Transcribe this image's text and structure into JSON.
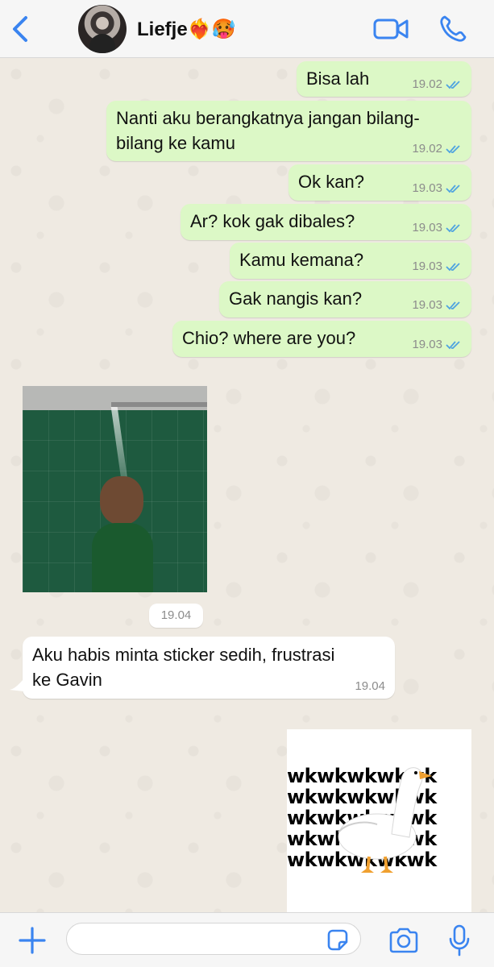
{
  "header": {
    "contact_name": "Liefje❤️‍🔥🥵",
    "back_icon": "chevron-left-icon",
    "video_icon": "video-call-icon",
    "call_icon": "phone-icon",
    "accent_color": "#3a84f0"
  },
  "messages": [
    {
      "direction": "out",
      "text": "Bisa lah",
      "time": "19.02",
      "status": "read"
    },
    {
      "direction": "out",
      "text": "Nanti aku berangkatnya jangan bilang-\nbilang ke kamu",
      "time": "19.02",
      "status": "read"
    },
    {
      "direction": "out",
      "text": "Ok kan?",
      "time": "19.03",
      "status": "read"
    },
    {
      "direction": "out",
      "text": "Ar? kok gak dibales?",
      "time": "19.03",
      "status": "read"
    },
    {
      "direction": "out",
      "text": "Kamu kemana?",
      "time": "19.03",
      "status": "read"
    },
    {
      "direction": "out",
      "text": "Gak nangis kan?",
      "time": "19.03",
      "status": "read"
    },
    {
      "direction": "out",
      "text": "Chio? where are you?",
      "time": "19.03",
      "status": "read"
    },
    {
      "direction": "in",
      "type": "sticker",
      "description": "crying-in-shower-sticker",
      "time": "19.04"
    },
    {
      "direction": "in",
      "text": "Aku habis minta sticker sedih, frustrasi\nke Gavin",
      "time": "19.04"
    },
    {
      "direction": "out",
      "type": "sticker",
      "description": "duck-wkwk-sticker",
      "sticker_text": "wkwkwkwkwk"
    }
  ],
  "footer": {
    "plus_icon": "plus-icon",
    "input_value": "",
    "sticker_icon": "sticker-icon",
    "camera_icon": "camera-icon",
    "mic_icon": "microphone-icon"
  },
  "colors": {
    "outgoing_bubble": "#dcf8c6",
    "incoming_bubble": "#ffffff",
    "read_ticks": "#4fa3e0",
    "chat_background": "#efeae2"
  }
}
